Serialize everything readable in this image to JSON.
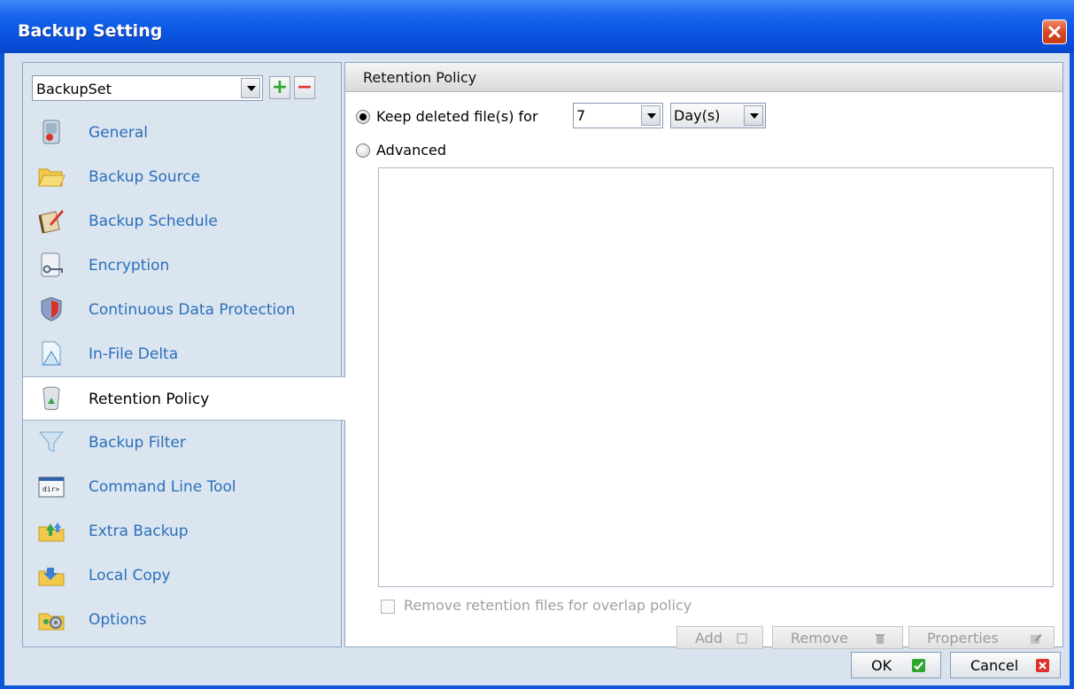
{
  "window": {
    "title": "Backup Setting"
  },
  "left": {
    "backupset_value": "BackupSet",
    "nav": [
      {
        "label": "General",
        "icon": "general-icon"
      },
      {
        "label": "Backup Source",
        "icon": "folder-icon"
      },
      {
        "label": "Backup Schedule",
        "icon": "calendar-icon"
      },
      {
        "label": "Encryption",
        "icon": "key-icon"
      },
      {
        "label": "Continuous Data Protection",
        "icon": "shield-icon"
      },
      {
        "label": "In-File Delta",
        "icon": "delta-icon"
      },
      {
        "label": "Retention Policy",
        "icon": "recycle-bin-icon"
      },
      {
        "label": "Backup Filter",
        "icon": "filter-icon"
      },
      {
        "label": "Command Line Tool",
        "icon": "command-line-icon"
      },
      {
        "label": "Extra Backup",
        "icon": "extra-backup-icon"
      },
      {
        "label": "Local Copy",
        "icon": "local-copy-icon"
      },
      {
        "label": "Options",
        "icon": "options-icon"
      }
    ],
    "active_index": 6
  },
  "right": {
    "header": "Retention Policy",
    "keep_label": "Keep deleted file(s) for",
    "keep_days": "7",
    "keep_unit": "Day(s)",
    "advanced_label": "Advanced",
    "overlap_label": "Remove retention files for overlap policy",
    "add_label": "Add",
    "remove_label": "Remove",
    "properties_label": "Properties"
  },
  "footer": {
    "ok_label": "OK",
    "cancel_label": "Cancel"
  },
  "colors": {
    "titlebar": "#0a55e3",
    "nav_text": "#2a6fba",
    "ok_green": "#2ea62e",
    "cancel_red": "#e0302a"
  }
}
